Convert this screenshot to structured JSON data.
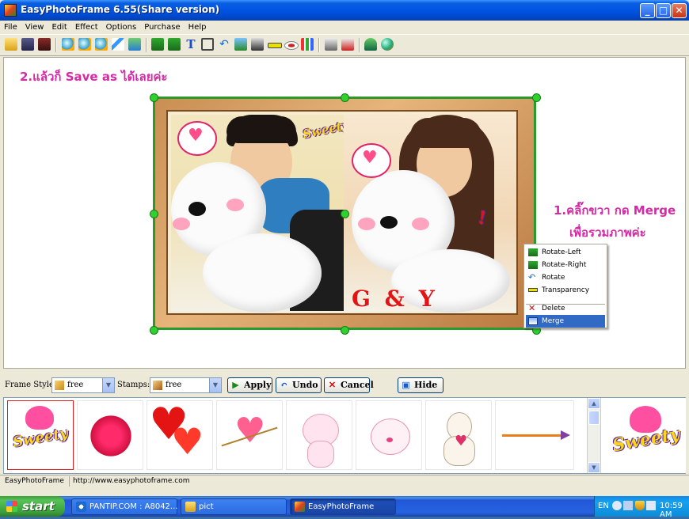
{
  "window": {
    "title": "EasyPhotoFrame 6.55(Share version)",
    "minimize": "_",
    "maximize": "□",
    "close": "✕"
  },
  "menu": [
    "File",
    "View",
    "Edit",
    "Effect",
    "Options",
    "Purchase",
    "Help"
  ],
  "toolbar_icons": [
    "open-icon",
    "save-icon",
    "save-as-icon",
    "zoom-in-icon",
    "zoom-out-icon",
    "zoom-fit-icon",
    "magic-wand-icon",
    "add-image-icon",
    "flip-left-icon",
    "flip-right-icon",
    "text-icon",
    "crop-icon",
    "undo-icon",
    "picture-icon",
    "portrait-icon",
    "transparency-icon",
    "eye-icon",
    "chart-icon",
    "print-icon",
    "print-preview-icon",
    "plugin-icon",
    "web-icon"
  ],
  "canvas": {
    "hint_top": "2.แล้วก็ Save as ได้เลยค่ะ",
    "hint_right_1": "1.คลิ๊กขวา กด Merge",
    "hint_right_2": "เพื่อรวมภาพค่ะ",
    "photo_text": "G & Y",
    "sticker_text": "Sweety"
  },
  "context_menu": [
    {
      "label": "Rotate-Left",
      "icon": "rotate-left-icon"
    },
    {
      "label": "Rotate-Right",
      "icon": "rotate-right-icon"
    },
    {
      "label": "Rotate",
      "icon": "rotate-icon"
    },
    {
      "label": "Transparency",
      "icon": "transparency-icon"
    },
    {
      "label": "Delete",
      "icon": "delete-icon"
    },
    {
      "label": "Merge",
      "icon": "merge-icon",
      "selected": true
    }
  ],
  "controls": {
    "frame_style_label": "Frame Style:",
    "frame_style_value": "free",
    "stamps_label": "Stamps:",
    "stamps_value": "free",
    "apply": "Apply",
    "undo": "Undo",
    "cancel": "Cancel",
    "hide": "Hide"
  },
  "stamps": [
    "sweety",
    "love",
    "hearts",
    "heart-arrow",
    "pink-cat",
    "pink-bunny",
    "rabbit-doll",
    "arrow"
  ],
  "statusbar": {
    "left": "EasyPhotoFrame",
    "right": "http://www.easyphotoframe.com"
  },
  "taskbar": {
    "start": "start",
    "tasks": [
      "PANTIP.COM : A8042...",
      "pict",
      "EasyPhotoFrame"
    ],
    "lang": "EN",
    "time": "10:59 AM"
  },
  "colors": {
    "hint_text": "#d42aa6",
    "selection_handles": "#2ed12e",
    "menu_highlight": "#316ac5"
  }
}
